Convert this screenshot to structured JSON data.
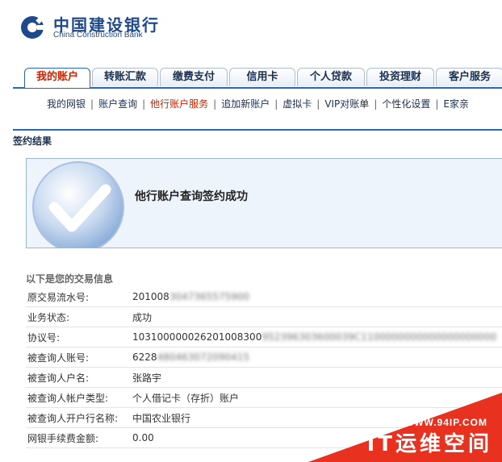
{
  "header": {
    "bank_name_cn": "中国建设银行",
    "bank_name_en": "China Construction Bank",
    "brand_color": "#1e4a8c"
  },
  "tabs": [
    {
      "label": "我的账户",
      "active": true
    },
    {
      "label": "转账汇款",
      "active": false
    },
    {
      "label": "缴费支付",
      "active": false
    },
    {
      "label": "信用卡",
      "active": false
    },
    {
      "label": "个人贷款",
      "active": false
    },
    {
      "label": "投资理财",
      "active": false
    },
    {
      "label": "客户服务",
      "active": false
    }
  ],
  "subnav": [
    {
      "label": "我的网银",
      "current": false
    },
    {
      "label": "账户查询",
      "current": false
    },
    {
      "label": "他行账户服务",
      "current": true
    },
    {
      "label": "追加新账户",
      "current": false
    },
    {
      "label": "虚拟卡",
      "current": false
    },
    {
      "label": "VIP对账单",
      "current": false
    },
    {
      "label": "个性化设置",
      "current": false
    },
    {
      "label": "E家亲",
      "current": false
    }
  ],
  "section_title": "签约结果",
  "result": {
    "icon": "check-icon",
    "message": "他行账户查询签约成功"
  },
  "info_title": "以下是您的交易信息",
  "info_rows": [
    {
      "label": "原交易流水号:",
      "value": "201008",
      "masked": "3047365575900"
    },
    {
      "label": "业务状态:",
      "value": "成功",
      "masked": ""
    },
    {
      "label": "协议号:",
      "value": "103100000026201008300",
      "masked": "952396303600039C1100000000000000000000"
    },
    {
      "label": "被查询人账号:",
      "value": "6228",
      "masked": "480463072090415"
    },
    {
      "label": "被查询人户名:",
      "value": "张路宇",
      "masked": ""
    },
    {
      "label": "被查询人帐户类型:",
      "value": "个人借记卡（存折）账户",
      "masked": ""
    },
    {
      "label": "被查询人开户行名称:",
      "value": "中国农业银行",
      "masked": ""
    },
    {
      "label": "网银手续费金额:",
      "value": "0.00",
      "masked": ""
    }
  ],
  "watermark": {
    "url": "WWW.94IP.COM",
    "name": "IT运维空间",
    "color": "#e8321f"
  }
}
